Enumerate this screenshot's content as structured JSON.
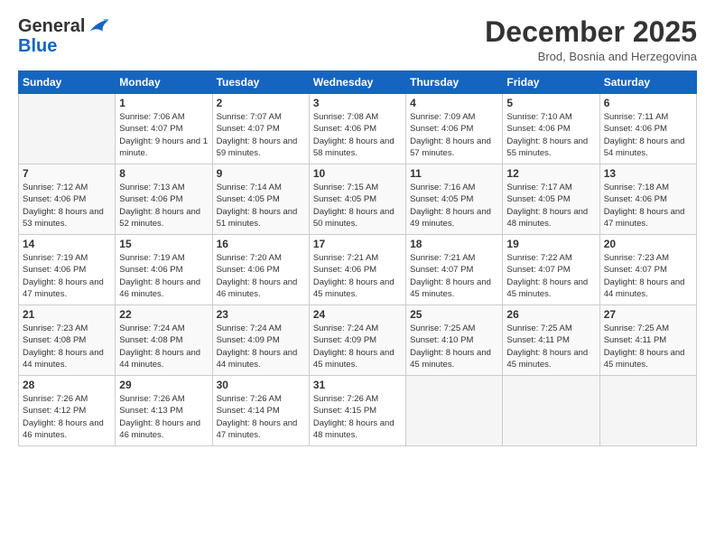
{
  "header": {
    "logo_general": "General",
    "logo_blue": "Blue",
    "month_title": "December 2025",
    "location": "Brod, Bosnia and Herzegovina"
  },
  "days_of_week": [
    "Sunday",
    "Monday",
    "Tuesday",
    "Wednesday",
    "Thursday",
    "Friday",
    "Saturday"
  ],
  "weeks": [
    [
      {
        "day": "",
        "sunrise": "",
        "sunset": "",
        "daylight": "",
        "empty": true
      },
      {
        "day": "1",
        "sunrise": "Sunrise: 7:06 AM",
        "sunset": "Sunset: 4:07 PM",
        "daylight": "Daylight: 9 hours and 1 minute."
      },
      {
        "day": "2",
        "sunrise": "Sunrise: 7:07 AM",
        "sunset": "Sunset: 4:07 PM",
        "daylight": "Daylight: 8 hours and 59 minutes."
      },
      {
        "day": "3",
        "sunrise": "Sunrise: 7:08 AM",
        "sunset": "Sunset: 4:06 PM",
        "daylight": "Daylight: 8 hours and 58 minutes."
      },
      {
        "day": "4",
        "sunrise": "Sunrise: 7:09 AM",
        "sunset": "Sunset: 4:06 PM",
        "daylight": "Daylight: 8 hours and 57 minutes."
      },
      {
        "day": "5",
        "sunrise": "Sunrise: 7:10 AM",
        "sunset": "Sunset: 4:06 PM",
        "daylight": "Daylight: 8 hours and 55 minutes."
      },
      {
        "day": "6",
        "sunrise": "Sunrise: 7:11 AM",
        "sunset": "Sunset: 4:06 PM",
        "daylight": "Daylight: 8 hours and 54 minutes."
      }
    ],
    [
      {
        "day": "7",
        "sunrise": "Sunrise: 7:12 AM",
        "sunset": "Sunset: 4:06 PM",
        "daylight": "Daylight: 8 hours and 53 minutes."
      },
      {
        "day": "8",
        "sunrise": "Sunrise: 7:13 AM",
        "sunset": "Sunset: 4:06 PM",
        "daylight": "Daylight: 8 hours and 52 minutes."
      },
      {
        "day": "9",
        "sunrise": "Sunrise: 7:14 AM",
        "sunset": "Sunset: 4:05 PM",
        "daylight": "Daylight: 8 hours and 51 minutes."
      },
      {
        "day": "10",
        "sunrise": "Sunrise: 7:15 AM",
        "sunset": "Sunset: 4:05 PM",
        "daylight": "Daylight: 8 hours and 50 minutes."
      },
      {
        "day": "11",
        "sunrise": "Sunrise: 7:16 AM",
        "sunset": "Sunset: 4:05 PM",
        "daylight": "Daylight: 8 hours and 49 minutes."
      },
      {
        "day": "12",
        "sunrise": "Sunrise: 7:17 AM",
        "sunset": "Sunset: 4:05 PM",
        "daylight": "Daylight: 8 hours and 48 minutes."
      },
      {
        "day": "13",
        "sunrise": "Sunrise: 7:18 AM",
        "sunset": "Sunset: 4:06 PM",
        "daylight": "Daylight: 8 hours and 47 minutes."
      }
    ],
    [
      {
        "day": "14",
        "sunrise": "Sunrise: 7:19 AM",
        "sunset": "Sunset: 4:06 PM",
        "daylight": "Daylight: 8 hours and 47 minutes."
      },
      {
        "day": "15",
        "sunrise": "Sunrise: 7:19 AM",
        "sunset": "Sunset: 4:06 PM",
        "daylight": "Daylight: 8 hours and 46 minutes."
      },
      {
        "day": "16",
        "sunrise": "Sunrise: 7:20 AM",
        "sunset": "Sunset: 4:06 PM",
        "daylight": "Daylight: 8 hours and 46 minutes."
      },
      {
        "day": "17",
        "sunrise": "Sunrise: 7:21 AM",
        "sunset": "Sunset: 4:06 PM",
        "daylight": "Daylight: 8 hours and 45 minutes."
      },
      {
        "day": "18",
        "sunrise": "Sunrise: 7:21 AM",
        "sunset": "Sunset: 4:07 PM",
        "daylight": "Daylight: 8 hours and 45 minutes."
      },
      {
        "day": "19",
        "sunrise": "Sunrise: 7:22 AM",
        "sunset": "Sunset: 4:07 PM",
        "daylight": "Daylight: 8 hours and 45 minutes."
      },
      {
        "day": "20",
        "sunrise": "Sunrise: 7:23 AM",
        "sunset": "Sunset: 4:07 PM",
        "daylight": "Daylight: 8 hours and 44 minutes."
      }
    ],
    [
      {
        "day": "21",
        "sunrise": "Sunrise: 7:23 AM",
        "sunset": "Sunset: 4:08 PM",
        "daylight": "Daylight: 8 hours and 44 minutes."
      },
      {
        "day": "22",
        "sunrise": "Sunrise: 7:24 AM",
        "sunset": "Sunset: 4:08 PM",
        "daylight": "Daylight: 8 hours and 44 minutes."
      },
      {
        "day": "23",
        "sunrise": "Sunrise: 7:24 AM",
        "sunset": "Sunset: 4:09 PM",
        "daylight": "Daylight: 8 hours and 44 minutes."
      },
      {
        "day": "24",
        "sunrise": "Sunrise: 7:24 AM",
        "sunset": "Sunset: 4:09 PM",
        "daylight": "Daylight: 8 hours and 45 minutes."
      },
      {
        "day": "25",
        "sunrise": "Sunrise: 7:25 AM",
        "sunset": "Sunset: 4:10 PM",
        "daylight": "Daylight: 8 hours and 45 minutes."
      },
      {
        "day": "26",
        "sunrise": "Sunrise: 7:25 AM",
        "sunset": "Sunset: 4:11 PM",
        "daylight": "Daylight: 8 hours and 45 minutes."
      },
      {
        "day": "27",
        "sunrise": "Sunrise: 7:25 AM",
        "sunset": "Sunset: 4:11 PM",
        "daylight": "Daylight: 8 hours and 45 minutes."
      }
    ],
    [
      {
        "day": "28",
        "sunrise": "Sunrise: 7:26 AM",
        "sunset": "Sunset: 4:12 PM",
        "daylight": "Daylight: 8 hours and 46 minutes."
      },
      {
        "day": "29",
        "sunrise": "Sunrise: 7:26 AM",
        "sunset": "Sunset: 4:13 PM",
        "daylight": "Daylight: 8 hours and 46 minutes."
      },
      {
        "day": "30",
        "sunrise": "Sunrise: 7:26 AM",
        "sunset": "Sunset: 4:14 PM",
        "daylight": "Daylight: 8 hours and 47 minutes."
      },
      {
        "day": "31",
        "sunrise": "Sunrise: 7:26 AM",
        "sunset": "Sunset: 4:15 PM",
        "daylight": "Daylight: 8 hours and 48 minutes."
      },
      {
        "day": "",
        "sunrise": "",
        "sunset": "",
        "daylight": "",
        "empty": true
      },
      {
        "day": "",
        "sunrise": "",
        "sunset": "",
        "daylight": "",
        "empty": true
      },
      {
        "day": "",
        "sunrise": "",
        "sunset": "",
        "daylight": "",
        "empty": true
      }
    ]
  ]
}
